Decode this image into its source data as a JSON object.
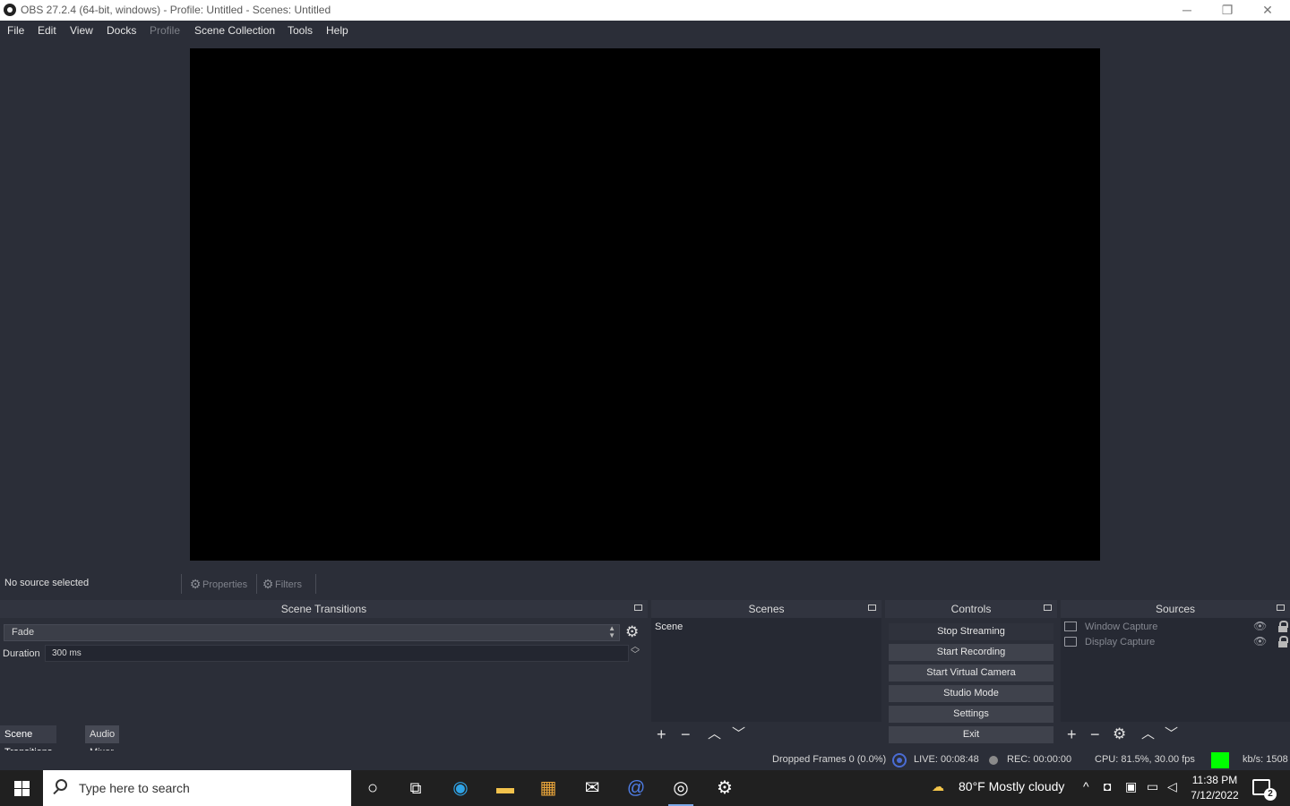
{
  "window": {
    "title": "OBS 27.2.4 (64-bit, windows) - Profile: Untitled - Scenes: Untitled",
    "minimize": "─",
    "restore": "❐",
    "close": "✕"
  },
  "menu": {
    "file": "File",
    "edit": "Edit",
    "view": "View",
    "docks": "Docks",
    "profile": "Profile",
    "scene_collection": "Scene Collection",
    "tools": "Tools",
    "help": "Help"
  },
  "source_toolbar": {
    "no_source": "No source selected",
    "properties": "Properties",
    "filters": "Filters"
  },
  "scene_transitions": {
    "title": "Scene Transitions",
    "selected": "Fade",
    "duration_label": "Duration",
    "duration_value": "300 ms"
  },
  "bottom_tabs": {
    "scene_transitions": "Scene Transitions",
    "audio_mixer": "Audio Mixer"
  },
  "scenes": {
    "title": "Scenes",
    "items": [
      "Scene"
    ]
  },
  "controls": {
    "title": "Controls",
    "stop_streaming": "Stop Streaming",
    "start_recording": "Start Recording",
    "start_virtual_camera": "Start Virtual Camera",
    "studio_mode": "Studio Mode",
    "settings": "Settings",
    "exit": "Exit"
  },
  "sources": {
    "title": "Sources",
    "items": [
      {
        "name": "Window Capture",
        "icon": "window-icon"
      },
      {
        "name": "Display Capture",
        "icon": "monitor-icon"
      }
    ]
  },
  "status": {
    "dropped_frames": "Dropped Frames 0 (0.0%)",
    "live": "LIVE: 00:08:48",
    "rec": "REC: 00:00:00",
    "cpu": "CPU: 81.5%, 30.00 fps",
    "kbps": "kb/s: 1508",
    "health_color": "#00ff00"
  },
  "taskbar": {
    "search_placeholder": "Type here to search",
    "weather": "80°F  Mostly cloudy",
    "time": "11:38 PM",
    "date": "7/12/2022",
    "notifications": "2"
  }
}
